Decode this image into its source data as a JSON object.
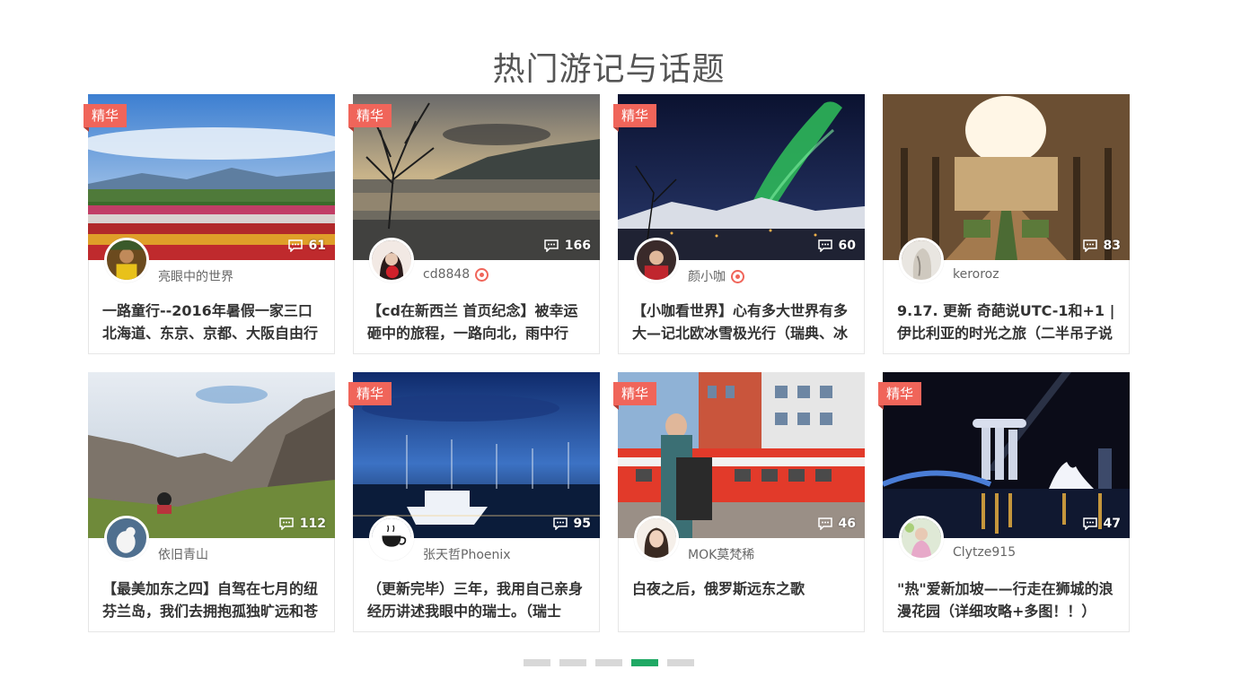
{
  "section_title": "热门游记与话题",
  "badge_label": "精华",
  "colors": {
    "badge": "#f0655a",
    "pager_active": "#1fa964",
    "pager_inactive": "#d8d8d8"
  },
  "cards": [
    {
      "author": "亮眼中的世界",
      "comments": "61",
      "title": "一路童行--2016年暑假一家三口北海道、东京、京都、大阪自由行",
      "featured": true,
      "verified": false
    },
    {
      "author": "cd8848",
      "comments": "166",
      "title": "【cd在新西兰 首页纪念】被幸运砸中的旅程，一路向北，雨中行",
      "featured": true,
      "verified": true
    },
    {
      "author": "颜小咖",
      "comments": "60",
      "title": "【小咖看世界】心有多大世界有多大—记北欧冰雪极光行（瑞典、冰",
      "featured": true,
      "verified": true
    },
    {
      "author": "keroroz",
      "comments": "83",
      "title": "9.17. 更新 奇葩说UTC-1和+1 | 伊比利亚的时光之旅（二半吊子说",
      "featured": false,
      "verified": false
    },
    {
      "author": "依旧青山",
      "comments": "112",
      "title": "【最美加东之四】自驾在七月的纽芬兰岛，我们去拥抱孤独旷远和苍",
      "featured": false,
      "verified": false
    },
    {
      "author": "张天哲Phoenix",
      "comments": "95",
      "title": "（更新完毕）三年，我用自己亲身经历讲述我眼中的瑞士。（瑞士",
      "featured": true,
      "verified": false
    },
    {
      "author": "MOK莫梵稀",
      "comments": "46",
      "title": "白夜之后，俄罗斯远东之歌",
      "featured": true,
      "verified": false
    },
    {
      "author": "Clytze915",
      "comments": "47",
      "title": "\"热\"爱新加坡——行走在狮城的浪漫花园（详细攻略+多图！！）",
      "featured": true,
      "verified": false
    }
  ],
  "pager": {
    "pages": 5,
    "active_index": 3
  }
}
